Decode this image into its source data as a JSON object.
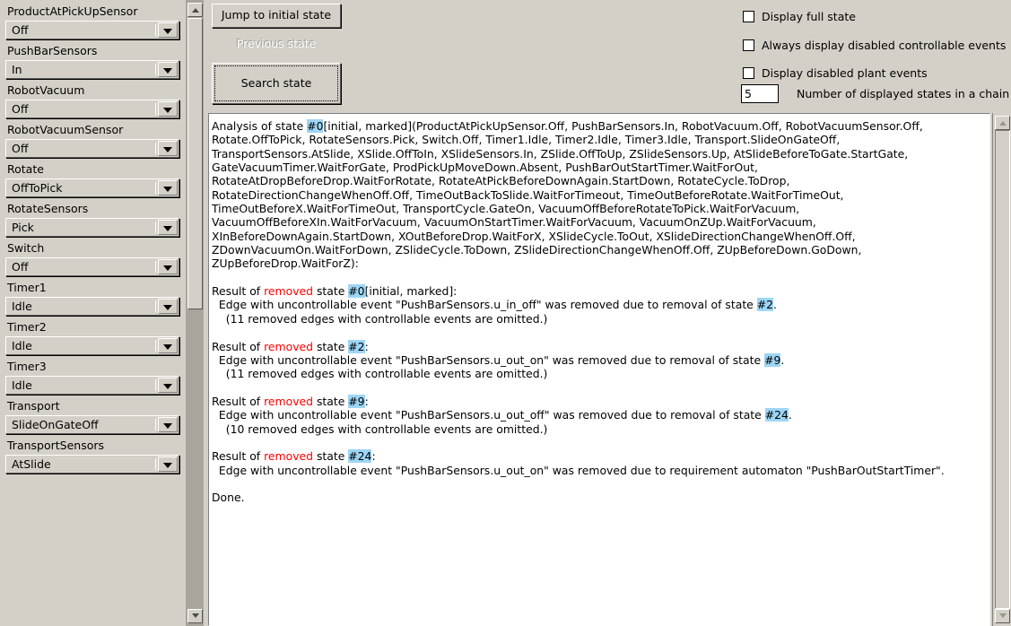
{
  "sidebar": {
    "variables": [
      {
        "label": "ProductAtPickUpSensor",
        "value": "Off"
      },
      {
        "label": "PushBarSensors",
        "value": "In"
      },
      {
        "label": "RobotVacuum",
        "value": "Off"
      },
      {
        "label": "RobotVacuumSensor",
        "value": "Off"
      },
      {
        "label": "Rotate",
        "value": "OffToPick"
      },
      {
        "label": "RotateSensors",
        "value": "Pick"
      },
      {
        "label": "Switch",
        "value": "Off"
      },
      {
        "label": "Timer1",
        "value": "Idle"
      },
      {
        "label": "Timer2",
        "value": "Idle"
      },
      {
        "label": "Timer3",
        "value": "Idle"
      },
      {
        "label": "Transport",
        "value": "SlideOnGateOff"
      },
      {
        "label": "TransportSensors",
        "value": "AtSlide"
      }
    ],
    "scrollbar": {
      "up_icon": "triangle-up-icon",
      "down_icon": "triangle-down-icon"
    }
  },
  "toolbar": {
    "jump_label": "Jump to initial state",
    "previous_label": "Previous state",
    "search_label": "Search state",
    "checkboxes": [
      {
        "label": "Display full state",
        "checked": false
      },
      {
        "label": "Always display disabled controllable events",
        "checked": false
      },
      {
        "label": "Display disabled plant events",
        "checked": false
      }
    ],
    "chain": {
      "value": "5",
      "label": "Number of displayed states in a chain"
    }
  },
  "output": {
    "segments": [
      {
        "t": "Analysis of state "
      },
      {
        "t": "#0",
        "c": "st"
      },
      {
        "t": "[initial, marked](ProductAtPickUpSensor.Off, PushBarSensors.In, RobotVacuum.Off, RobotVacuumSensor.Off,\nRotate.OffToPick, RotateSensors.Pick, Switch.Off, Timer1.Idle, Timer2.Idle, Timer3.Idle, Transport.SlideOnGateOff,\nTransportSensors.AtSlide, XSlide.OffToIn, XSlideSensors.In, ZSlide.OffToUp, ZSlideSensors.Up, AtSlideBeforeToGate.StartGate,\nGateVacuumTimer.WaitForGate, ProdPickUpMoveDown.Absent, PushBarOutStartTimer.WaitForOut,\nRotateAtDropBeforeDrop.WaitForRotate, RotateAtPickBeforeDownAgain.StartDown, RotateCycle.ToDrop,\nRotateDirectionChangeWhenOff.Off, TimeOutBackToSlide.WaitForTimeout, TimeOutBeforeRotate.WaitForTimeOut,\nTimeOutBeforeX.WaitForTimeOut, TransportCycle.GateOn, VacuumOffBeforeRotateToPick.WaitForVacuum,\nVacuumOffBeforeXIn.WaitForVacuum, VacuumOnStartTimer.WaitForVacuum, VacuumOnZUp.WaitForVacuum,\nXInBeforeDownAgain.StartDown, XOutBeforeDrop.WaitForX, XSlideCycle.ToOut, XSlideDirectionChangeWhenOff.Off,\nZDownVacuumOn.WaitForDown, ZSlideCycle.ToDown, ZSlideDirectionChangeWhenOff.Off, ZUpBeforeDown.GoDown,\nZUpBeforeDrop.WaitForZ):\n\n"
      },
      {
        "t": "Result of "
      },
      {
        "t": "removed",
        "c": "rm"
      },
      {
        "t": " state "
      },
      {
        "t": "#0",
        "c": "st"
      },
      {
        "t": "[initial, marked]:\n  Edge with uncontrollable event \"PushBarSensors.u_in_off\" was removed due to removal of state "
      },
      {
        "t": "#2",
        "c": "st"
      },
      {
        "t": ".\n    (11 removed edges with controllable events are omitted.)\n\n"
      },
      {
        "t": "Result of "
      },
      {
        "t": "removed",
        "c": "rm"
      },
      {
        "t": " state "
      },
      {
        "t": "#2",
        "c": "st"
      },
      {
        "t": ":\n  Edge with uncontrollable event \"PushBarSensors.u_out_on\" was removed due to removal of state "
      },
      {
        "t": "#9",
        "c": "st"
      },
      {
        "t": ".\n    (11 removed edges with controllable events are omitted.)\n\n"
      },
      {
        "t": "Result of "
      },
      {
        "t": "removed",
        "c": "rm"
      },
      {
        "t": " state "
      },
      {
        "t": "#9",
        "c": "st"
      },
      {
        "t": ":\n  Edge with uncontrollable event \"PushBarSensors.u_out_off\" was removed due to removal of state "
      },
      {
        "t": "#24",
        "c": "st"
      },
      {
        "t": ".\n    (10 removed edges with controllable events are omitted.)\n\n"
      },
      {
        "t": "Result of "
      },
      {
        "t": "removed",
        "c": "rm"
      },
      {
        "t": " state "
      },
      {
        "t": "#24",
        "c": "st"
      },
      {
        "t": ":\n  Edge with uncontrollable event \"PushBarSensors.u_out_on\" was removed due to requirement automaton \"PushBarOutStartTimer\".\n\nDone."
      }
    ]
  },
  "colors": {
    "face": "#d4d0c8",
    "state_highlight": "#9ed5f5",
    "removed_text": "#ff0000",
    "text_bg": "#ffffff"
  }
}
